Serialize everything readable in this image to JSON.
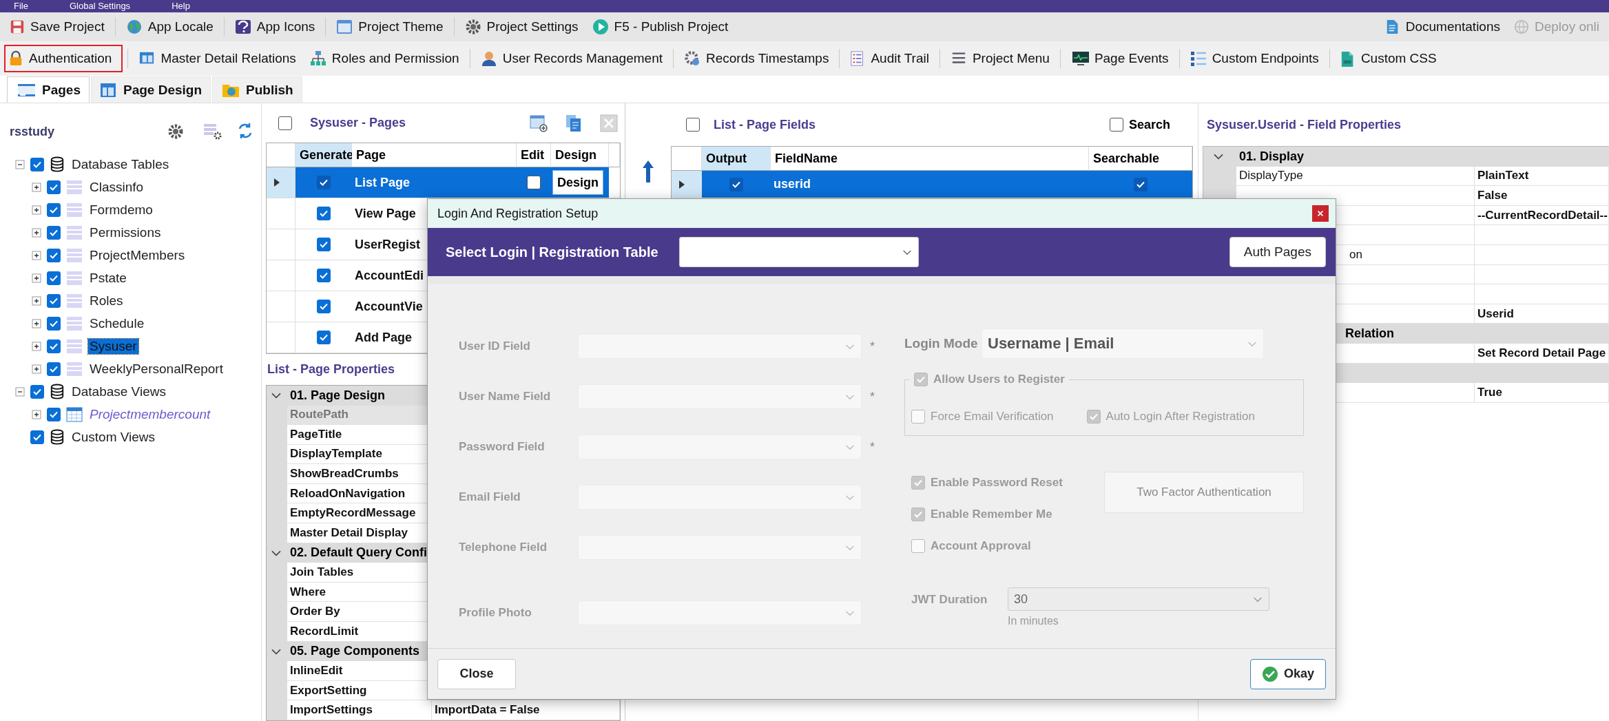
{
  "menu_bar": [
    "File",
    "Global Settings",
    "Help"
  ],
  "toolbar_main": {
    "items": [
      {
        "label": "Save Project"
      },
      {
        "label": "App Locale"
      },
      {
        "label": "App Icons"
      },
      {
        "label": "Project Theme"
      },
      {
        "label": "Project Settings"
      },
      {
        "label": "F5 - Publish Project"
      }
    ],
    "right_items": [
      {
        "label": "Documentations",
        "disabled": false
      },
      {
        "label": "Deploy onli",
        "disabled": true
      }
    ]
  },
  "toolbar_features": [
    {
      "label": "Authentication",
      "highlighted": true
    },
    {
      "label": "Master Detail Relations",
      "highlighted": false
    },
    {
      "label": "Roles and Permission",
      "highlighted": false
    },
    {
      "label": "User Records Management",
      "highlighted": false
    },
    {
      "label": "Records Timestamps",
      "highlighted": false
    },
    {
      "label": "Audit Trail",
      "highlighted": false
    },
    {
      "label": "Project Menu",
      "highlighted": false
    },
    {
      "label": "Page Events",
      "highlighted": false
    },
    {
      "label": "Custom Endpoints",
      "highlighted": false
    },
    {
      "label": "Custom CSS",
      "highlighted": false
    }
  ],
  "tabs": [
    {
      "label": "Pages",
      "selected": true
    },
    {
      "label": "Page Design",
      "selected": false
    },
    {
      "label": "Publish",
      "selected": false
    }
  ],
  "project_tree": {
    "title": "rsstudy",
    "nodes": [
      {
        "kind": "group",
        "label": "Database Tables",
        "checked": true,
        "expanded": true,
        "selected": false,
        "children": [
          {
            "kind": "table",
            "label": "Classinfo",
            "checked": true,
            "expanded": false,
            "selected": false
          },
          {
            "kind": "table",
            "label": "Formdemo",
            "checked": true,
            "expanded": false,
            "selected": false
          },
          {
            "kind": "table",
            "label": "Permissions",
            "checked": true,
            "expanded": false,
            "selected": false
          },
          {
            "kind": "table",
            "label": "ProjectMembers",
            "checked": true,
            "expanded": false,
            "selected": false
          },
          {
            "kind": "table",
            "label": "Pstate",
            "checked": true,
            "expanded": false,
            "selected": false
          },
          {
            "kind": "table",
            "label": "Roles",
            "checked": true,
            "expanded": false,
            "selected": false
          },
          {
            "kind": "table",
            "label": "Schedule",
            "checked": true,
            "expanded": false,
            "selected": false
          },
          {
            "kind": "table",
            "label": "Sysuser",
            "checked": true,
            "expanded": false,
            "selected": true
          },
          {
            "kind": "table",
            "label": "WeeklyPersonalReport",
            "checked": true,
            "expanded": false,
            "selected": false
          }
        ]
      },
      {
        "kind": "group",
        "label": "Database Views",
        "checked": true,
        "expanded": true,
        "selected": false,
        "children": [
          {
            "kind": "view",
            "label": "Projectmembercount",
            "checked": true,
            "expanded": false,
            "selected": false
          }
        ]
      },
      {
        "kind": "group",
        "label": "Custom Views",
        "checked": true,
        "selected": false
      }
    ]
  },
  "pages_panel": {
    "title": "Sysuser - Pages",
    "select_all": false,
    "columns": [
      "Generate",
      "Page",
      "Edit",
      "Design"
    ],
    "rows": [
      {
        "page": "List Page",
        "generate": true,
        "selected": true,
        "edit": false,
        "design": "Design"
      },
      {
        "page": "View Page",
        "generate": true,
        "selected": false
      },
      {
        "page": "UserRegist",
        "generate": true,
        "selected": false
      },
      {
        "page": "AccountEdi",
        "generate": true,
        "selected": false
      },
      {
        "page": "AccountVie",
        "generate": true,
        "selected": false
      },
      {
        "page": "Add Page",
        "generate": true,
        "selected": false
      }
    ]
  },
  "page_properties": {
    "title": "List - Page Properties",
    "groups": [
      {
        "label": "01. Page Design",
        "expanded": true,
        "rows": [
          {
            "name": "RoutePath",
            "disabled": true
          },
          {
            "name": "PageTitle",
            "disabled": false
          },
          {
            "name": "DisplayTemplate",
            "disabled": false
          },
          {
            "name": "ShowBreadCrumbs",
            "disabled": false
          },
          {
            "name": "ReloadOnNavigation",
            "disabled": false
          },
          {
            "name": "EmptyRecordMessage",
            "disabled": false
          },
          {
            "name": "Master Detail Display",
            "disabled": false
          }
        ]
      },
      {
        "label": "02. Default Query Confi",
        "expanded": true,
        "rows": [
          {
            "name": "Join Tables",
            "disabled": false
          },
          {
            "name": "Where",
            "disabled": false
          },
          {
            "name": "Order By",
            "disabled": false
          },
          {
            "name": "RecordLimit",
            "disabled": false
          }
        ]
      },
      {
        "label": "05. Page Components",
        "expanded": true,
        "rows": [
          {
            "name": "InlineEdit",
            "disabled": false
          },
          {
            "name": "ExportSetting",
            "disabled": false
          },
          {
            "name": "ImportSettings",
            "value": "ImportData = False",
            "disabled": false
          }
        ]
      }
    ]
  },
  "fields_panel": {
    "title": "List - Page Fields",
    "select_all": false,
    "search": {
      "label": "Search",
      "checked": false
    },
    "columns": [
      "Output",
      "FieldName",
      "Searchable"
    ],
    "rows": [
      {
        "field": "userid",
        "output": true,
        "searchable": true,
        "selected": true
      }
    ]
  },
  "field_properties": {
    "title": "Sysuser.Userid - Field Properties",
    "rows": [
      {
        "kind": "group",
        "label": "01. Display"
      },
      {
        "kind": "prop",
        "name": "DisplayType",
        "value": "PlainText"
      },
      {
        "kind": "prop",
        "value": "False"
      },
      {
        "kind": "prop",
        "value": "--CurrentRecordDetail--"
      },
      {
        "kind": "prop"
      },
      {
        "kind": "prop_tail",
        "name": "on"
      },
      {
        "kind": "prop"
      },
      {
        "kind": "prop"
      },
      {
        "kind": "prop",
        "value": "Userid"
      },
      {
        "kind": "group_tail",
        "label": "Relation"
      },
      {
        "kind": "prop",
        "value": "Set Record Detail Page"
      },
      {
        "kind": "group"
      },
      {
        "kind": "prop",
        "value": "True"
      }
    ]
  },
  "dialog": {
    "title": "Login And Registration Setup",
    "header_label": "Select Login | Registration Table",
    "auth_button": "Auth Pages",
    "fields": [
      {
        "label": "User ID Field",
        "required_mark": "*"
      },
      {
        "label": "User Name Field",
        "required_mark": "*"
      },
      {
        "label": "Password Field",
        "required_mark": "*"
      },
      {
        "label": "Email Field"
      },
      {
        "label": "Telephone Field"
      },
      {
        "label": "Profile Photo"
      }
    ],
    "login_mode": {
      "label": "Login Mode",
      "value": "Username | Email"
    },
    "allow_register": {
      "label": "Allow Users to Register",
      "checked": true
    },
    "register_options": [
      {
        "label": "Force Email Verification",
        "checked": false
      },
      {
        "label": "Auto Login After Registration",
        "checked": true
      }
    ],
    "options": [
      {
        "label": "Enable Password Reset",
        "checked": true
      },
      {
        "label": "Enable Remember Me",
        "checked": true
      },
      {
        "label": "Account Approval",
        "checked": false
      }
    ],
    "two_factor_button": "Two Factor Authentication",
    "jwt": {
      "label": "JWT Duration",
      "value": "30",
      "hint": "In minutes"
    },
    "close_button": "Close",
    "okay_button": "Okay"
  }
}
